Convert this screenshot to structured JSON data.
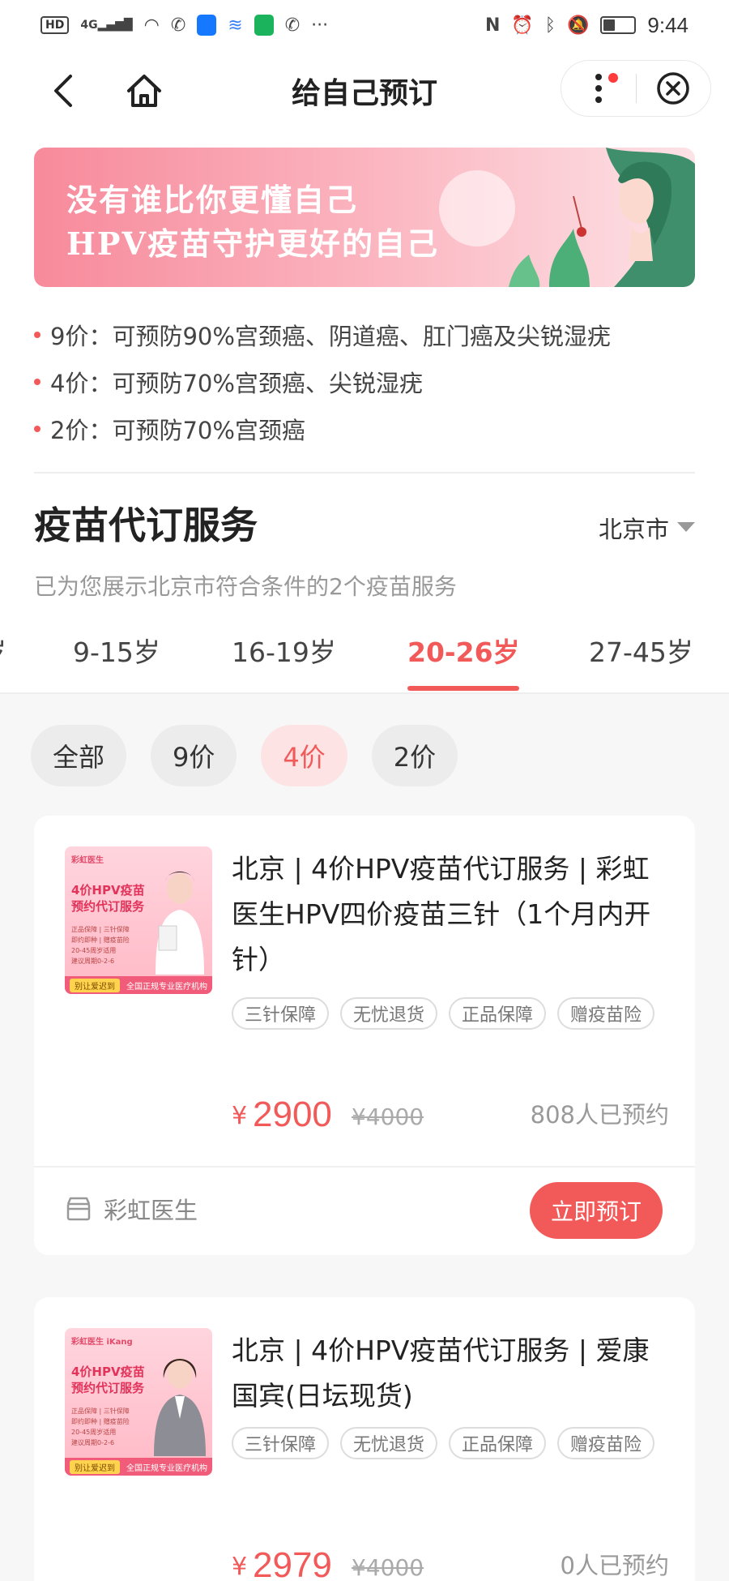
{
  "status_bar": {
    "left_badge": "HD",
    "network": "4G",
    "ellipsis": "···",
    "time": "9:44"
  },
  "nav": {
    "title": "给自己预订"
  },
  "banner": {
    "line1": "没有谁比你更懂自己",
    "line2": "HPV疫苗守护更好的自己"
  },
  "bullets": [
    "9价：可预防90%宫颈癌、阴道癌、肛门癌及尖锐湿疣",
    "4价：可预防70%宫颈癌、尖锐湿疣",
    "2价：可预防70%宫颈癌"
  ],
  "section": {
    "title": "疫苗代订服务",
    "city": "北京市",
    "subtitle": "已为您展示北京市符合条件的2个疫苗服务"
  },
  "age_tabs": [
    {
      "label": "岁",
      "active": false
    },
    {
      "label": "9-15岁",
      "active": false
    },
    {
      "label": "16-19岁",
      "active": false
    },
    {
      "label": "20-26岁",
      "active": true
    },
    {
      "label": "27-45岁",
      "active": false
    }
  ],
  "filters": [
    {
      "label": "全部",
      "active": false
    },
    {
      "label": "9价",
      "active": false
    },
    {
      "label": "4价",
      "active": true
    },
    {
      "label": "2价",
      "active": false
    }
  ],
  "products": [
    {
      "title": "北京 | 4价HPV疫苗代订服务 | 彩虹医生HPV四价疫苗三针（1个月内开针）",
      "tags": [
        "三针保障",
        "无忧退货",
        "正品保障",
        "赠疫苗险"
      ],
      "currency": "¥",
      "price": "2900",
      "original_price": "¥4000",
      "booked": "808人已预约",
      "shop": "彩虹医生",
      "book_label": "立即预订",
      "thumb": {
        "brand": "彩虹医生",
        "title": "4价HPV疫苗预约代订服务",
        "lines": [
          "正品保障 | 三针保障",
          "即约即种 | 赠疫苗险",
          "20-45周岁适用",
          "建议周期0-2-6"
        ],
        "footer_left": "别让爱迟到",
        "footer_right": "全国正规专业医疗机构"
      }
    },
    {
      "title": "北京 | 4价HPV疫苗代订服务 | 爱康国宾(日坛现货)",
      "tags": [
        "三针保障",
        "无忧退货",
        "正品保障",
        "赠疫苗险"
      ],
      "currency": "¥",
      "price": "2979",
      "original_price": "¥4000",
      "booked": "0人已预约",
      "thumb": {
        "brand": "彩虹医生 iKang",
        "title": "4价HPV疫苗预约代订服务",
        "lines": [
          "正品保障 | 三针保障",
          "即约即种 | 赠疫苗险",
          "20-45周岁适用",
          "建议周期0-2-6"
        ],
        "footer_left": "别让爱迟到",
        "footer_right": "全国正规专业医疗机构"
      }
    }
  ],
  "colors": {
    "accent": "#f25a5a",
    "chip_active_bg": "#fde3e3",
    "banner_pink": "#f78a9b"
  }
}
